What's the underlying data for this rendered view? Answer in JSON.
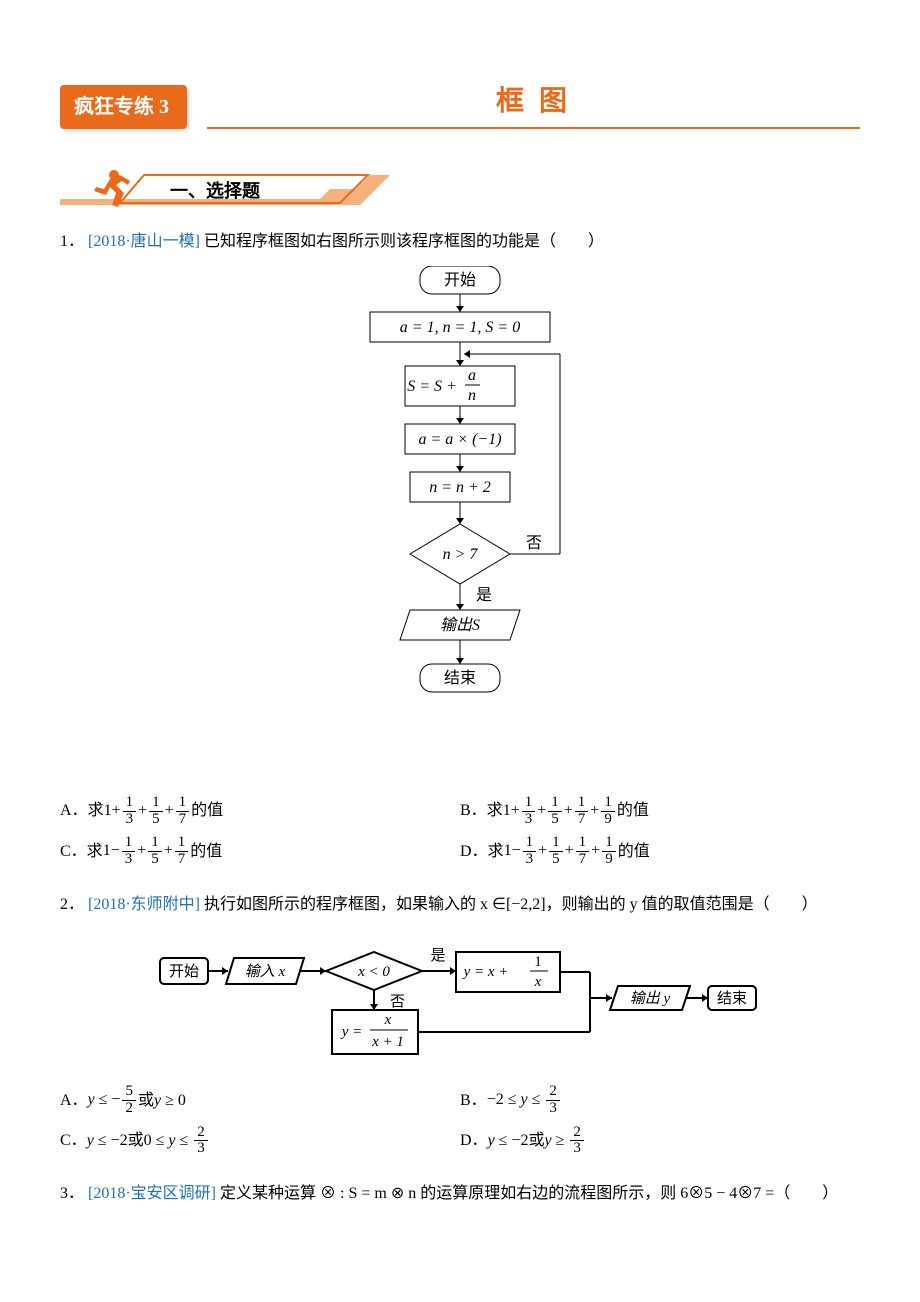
{
  "header": {
    "badge": "疯狂专练 3",
    "title": "框 图"
  },
  "section1": {
    "label": "一、选择题"
  },
  "q1": {
    "num": "1．",
    "source": "[2018·唐山一模]",
    "text": "已知程序框图如右图所示则该程序框图的功能是（　　）",
    "flow": {
      "start": "开始",
      "init": "a = 1, n = 1, S = 0",
      "step1_l": "S = S +",
      "step1_num": "a",
      "step1_den": "n",
      "step2": "a = a × (−1)",
      "step3": "n = n + 2",
      "cond": "n > 7",
      "yes": "是",
      "no": "否",
      "out": "输出S",
      "end": "结束"
    },
    "opts": {
      "A_pre": "A．求",
      "A_txt": " 的值",
      "B_pre": "B．求",
      "B_txt": " 的值",
      "C_pre": "C．求",
      "C_txt": " 的值",
      "D_pre": "D．求",
      "D_txt": " 的值"
    }
  },
  "q2": {
    "num": "2．",
    "source": "[2018·东师附中]",
    "text": "执行如图所示的程序框图，如果输入的 x ∈[−2,2]，则输出的 y 值的取值范围是（　　）",
    "flow": {
      "start": "开始",
      "in": "输入 x",
      "cond": "x < 0",
      "yes": "是",
      "no": "否",
      "b1_l": "y = x +",
      "b1_num": "1",
      "b1_den": "x",
      "b2_l": "y =",
      "b2_num": "x",
      "b2_den": "x + 1",
      "out": "输出 y",
      "end": "结束"
    },
    "opts": {
      "A_pre": "A．",
      "A_mid": " 或 ",
      "B_pre": "B．",
      "C_pre": "C．",
      "C_mid": " 或 ",
      "D_pre": "D．",
      "D_mid": " 或 "
    }
  },
  "q3": {
    "num": "3．",
    "source": "[2018·宝安区调研]",
    "text": "定义某种运算 ⊗ : S = m ⊗ n 的运算原理如右边的流程图所示，则 6⊗5 − 4⊗7 =（　　）"
  }
}
